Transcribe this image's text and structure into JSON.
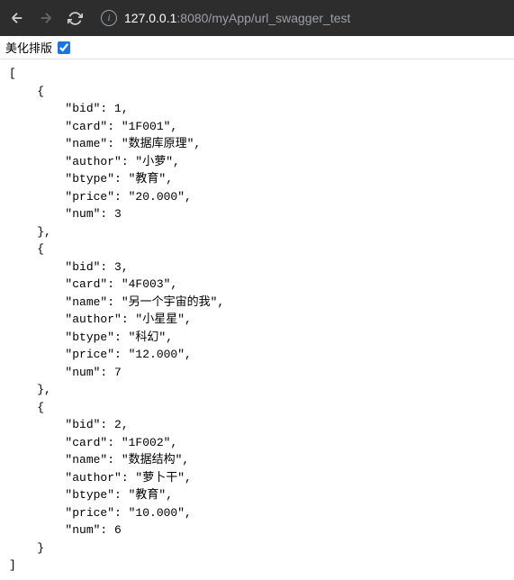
{
  "url": {
    "host": "127.0.0.1",
    "port_path": ":8080/myApp/url_swagger_test"
  },
  "pretty_print": {
    "label": "美化排版",
    "checked": true
  },
  "json_response": [
    {
      "bid": 1,
      "card": "1F001",
      "name": "数据库原理",
      "author": "小萝",
      "btype": "教育",
      "price": "20.000",
      "num": 3
    },
    {
      "bid": 3,
      "card": "4F003",
      "name": "另一个宇宙的我",
      "author": "小星星",
      "btype": "科幻",
      "price": "12.000",
      "num": 7
    },
    {
      "bid": 2,
      "card": "1F002",
      "name": "数据结构",
      "author": "萝卜干",
      "btype": "教育",
      "price": "10.000",
      "num": 6
    }
  ]
}
